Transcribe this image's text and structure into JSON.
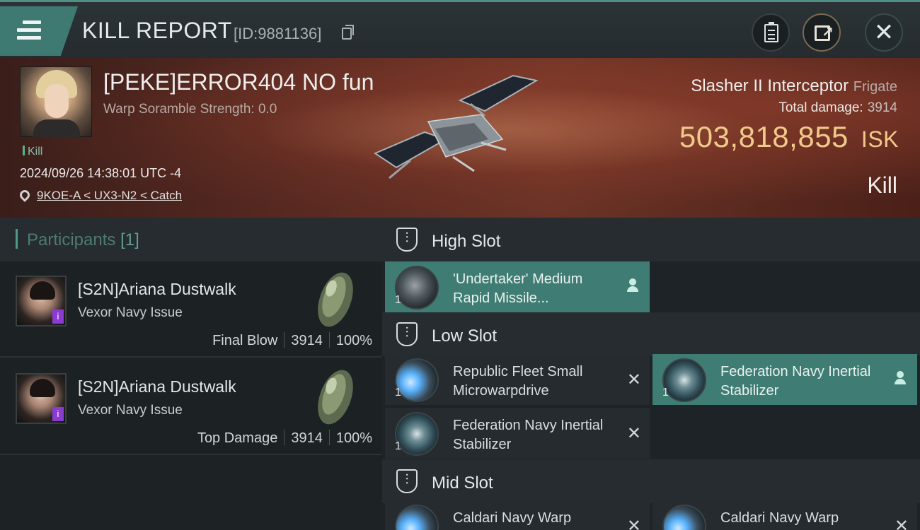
{
  "header": {
    "title": "KILL REPORT",
    "report_id": "[ID:9881136]"
  },
  "victim": {
    "name": "[PEKE]ERROR404 NO fun",
    "scramble": "Warp Soramble Strength: 0.0",
    "tag": "Kill",
    "datetime": "2024/09/26 14:38:01 UTC -4",
    "location": "9KOE-A < UX3-N2 < Catch"
  },
  "ship": {
    "name": "Slasher II Interceptor",
    "class": "Frigate",
    "damage_label": "Total damage:",
    "damage_value": "3914",
    "isk_value": "503,818,855",
    "isk_unit": "ISK",
    "result": "Kill"
  },
  "participants": {
    "title": "Participants",
    "count": "[1]",
    "rows": [
      {
        "name": "[S2N]Ariana Dustwalk",
        "ship": "Vexor Navy Issue",
        "role": "Final Blow",
        "damage": "3914",
        "percent": "100%"
      },
      {
        "name": "[S2N]Ariana Dustwalk",
        "ship": "Vexor Navy Issue",
        "role": "Top Damage",
        "damage": "3914",
        "percent": "100%"
      }
    ]
  },
  "slots": {
    "high": {
      "title": "High Slot",
      "modules": [
        {
          "qty": "1",
          "name": "'Undertaker' Medium Rapid Missile...",
          "state": "dropped"
        }
      ]
    },
    "low": {
      "title": "Low Slot",
      "modules": [
        {
          "qty": "1",
          "name": "Republic Fleet Small Microwarpdrive",
          "state": "destroyed"
        },
        {
          "qty": "1",
          "name": "Federation Navy Inertial Stabilizer",
          "state": "dropped"
        },
        {
          "qty": "1",
          "name": "Federation Navy Inertial Stabilizer",
          "state": "destroyed"
        }
      ]
    },
    "mid": {
      "title": "Mid Slot",
      "modules": [
        {
          "qty": "1",
          "name": "Caldari Navy Warp",
          "state": "destroyed"
        },
        {
          "qty": "1",
          "name": "Caldari Navy Warp",
          "state": "destroyed"
        }
      ]
    }
  },
  "colors": {
    "accent": "#3f7d74",
    "isk": "#f1c98a",
    "participants_title": "#4f7a74"
  }
}
